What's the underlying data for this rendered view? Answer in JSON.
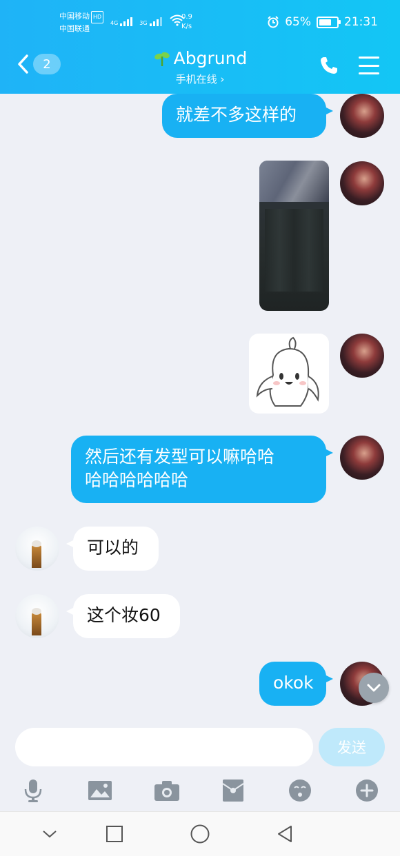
{
  "status_bar": {
    "carrier1": "中国移动",
    "hd": "HD",
    "carrier2": "中国联通",
    "net1": "4G",
    "net2": "3G",
    "speed_value": "0.9",
    "speed_unit": "K/s",
    "battery": "65%",
    "time": "21:31"
  },
  "header": {
    "unread_count": "2",
    "title": "Abgrund",
    "subtitle": "手机在线 ›"
  },
  "messages": [
    {
      "side": "out",
      "type": "text",
      "text": "就差不多这样的"
    },
    {
      "side": "out",
      "type": "image",
      "icon": "clothing-photo"
    },
    {
      "side": "out",
      "type": "sticker",
      "icon": "white-bunny-sticker"
    },
    {
      "side": "out",
      "type": "text",
      "line1": "然后还有发型可以嘛哈哈",
      "line2": "哈哈哈哈哈哈"
    },
    {
      "side": "in",
      "type": "text",
      "text": "可以的"
    },
    {
      "side": "in",
      "type": "text",
      "text": "这个妆60"
    },
    {
      "side": "out",
      "type": "text",
      "text": "okok"
    }
  ],
  "input": {
    "placeholder": "",
    "send_label": "发送"
  },
  "toolbar": [
    "mic-icon",
    "image-icon",
    "camera-icon",
    "red-packet-icon",
    "emoji-icon",
    "plus-icon"
  ],
  "colors": {
    "header": "#1fb3f7",
    "outgoing_bubble": "#18b1f3",
    "background": "#eef0f6"
  }
}
